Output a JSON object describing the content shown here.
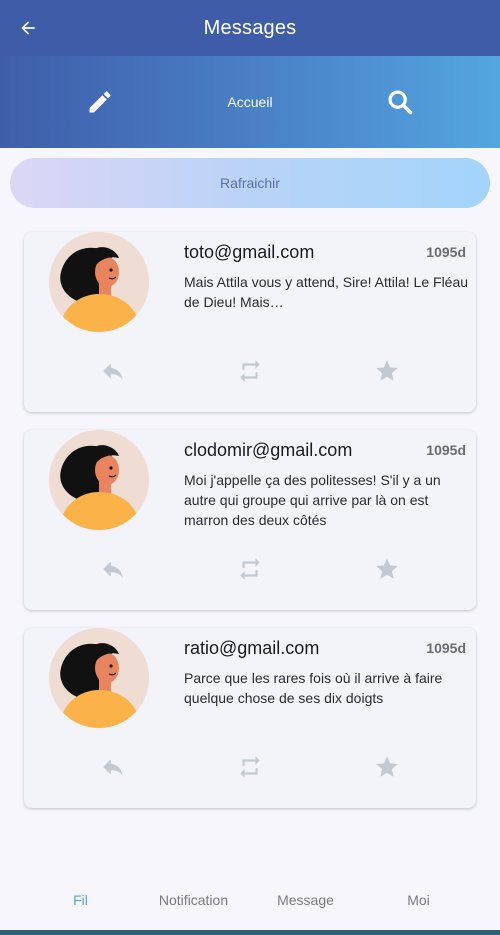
{
  "app_bar": {
    "title": "Messages",
    "back_icon": "arrow-left-icon"
  },
  "toolbar": {
    "compose_icon": "pencil-icon",
    "home_label": "Accueil",
    "search_icon": "search-icon"
  },
  "refresh": {
    "label": "Rafraichir"
  },
  "messages": [
    {
      "email": "toto@gmail.com",
      "age": "1095d",
      "text": "Mais Attila vous y attend, Sire! Attila! Le Fléau de Dieu! Mais…"
    },
    {
      "email": "clodomir@gmail.com",
      "age": "1095d",
      "text": "Moi j'appelle ça des politesses! S'il y a un autre qui groupe qui arrive par là on est marron des deux côtés"
    },
    {
      "email": "ratio@gmail.com",
      "age": "1095d",
      "text": "Parce que les rares fois où il arrive à faire quelque chose de ses dix doigts"
    }
  ],
  "bottom_nav": {
    "items": [
      "Fil",
      "Notification",
      "Message",
      "Moi"
    ],
    "active": "Fil"
  },
  "colors": {
    "app_bar": "#3e5ca8",
    "accent": "#53a6e0",
    "card": "#f3f4f9",
    "icon_muted": "#c3c9d3"
  }
}
